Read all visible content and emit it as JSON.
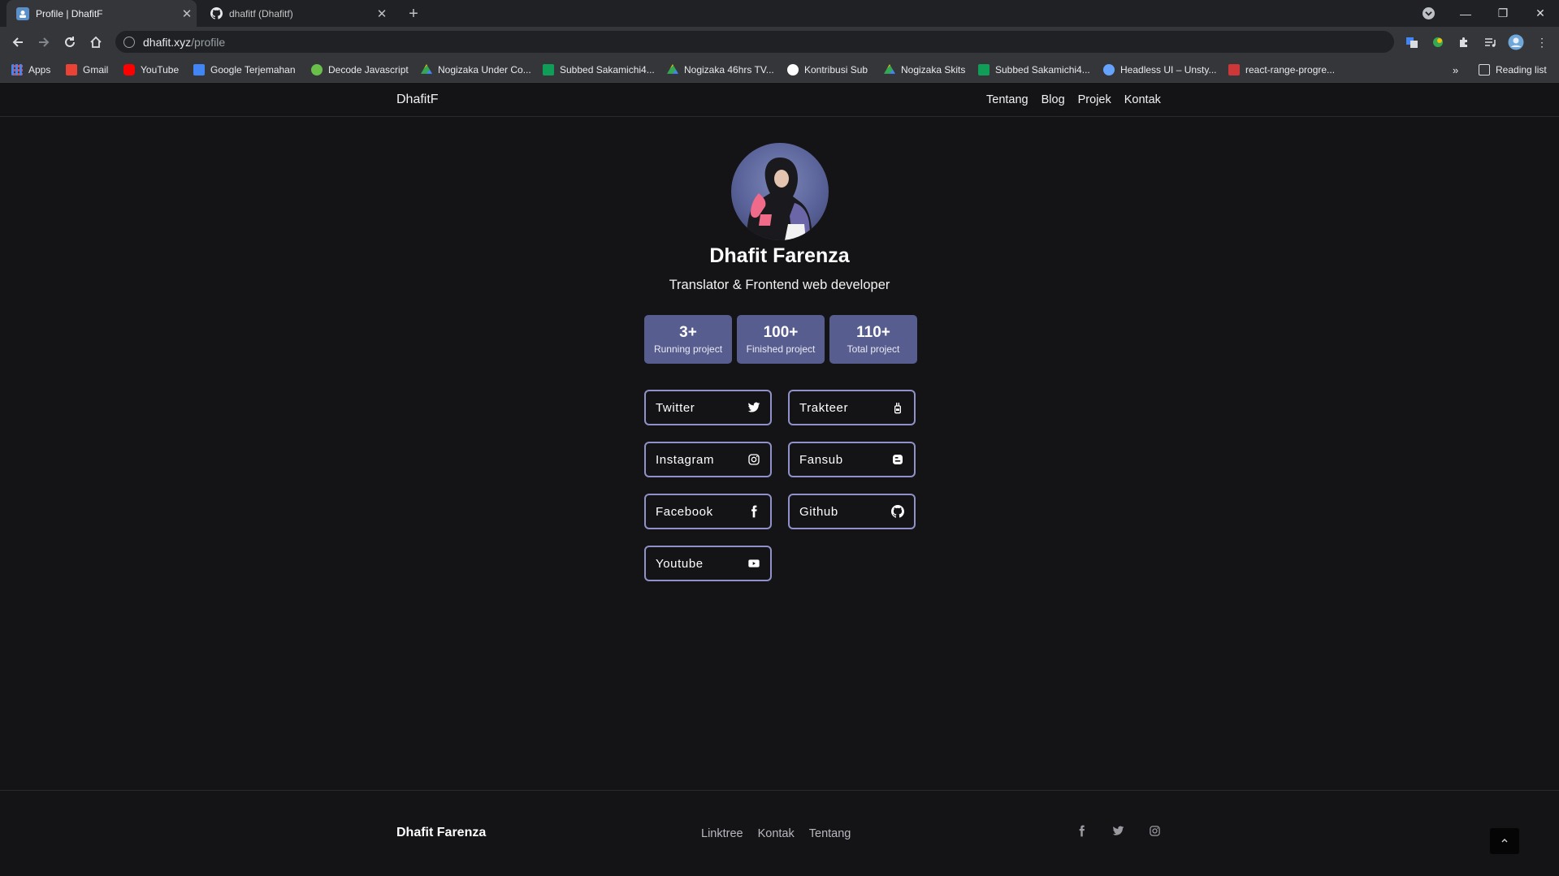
{
  "browser": {
    "tabs": [
      {
        "title": "Profile | DhafitF",
        "active": true
      },
      {
        "title": "dhafitf (Dhafitf)",
        "active": false
      }
    ],
    "address": {
      "host": "dhafit.xyz",
      "path": "/profile"
    },
    "bookmarks": [
      {
        "label": "Apps",
        "color": "#4285f4"
      },
      {
        "label": "Gmail",
        "color": "#ea4335"
      },
      {
        "label": "YouTube",
        "color": "#ff0000"
      },
      {
        "label": "Google Terjemahan",
        "color": "#4285f4"
      },
      {
        "label": "Decode Javascript",
        "color": "#6abf4b"
      },
      {
        "label": "Nogizaka Under Co...",
        "color": "#fbbc04"
      },
      {
        "label": "Subbed Sakamichi4...",
        "color": "#0f9d58"
      },
      {
        "label": "Nogizaka 46hrs TV...",
        "color": "#fbbc04"
      },
      {
        "label": "Kontribusi Sub",
        "color": "#ffffff"
      },
      {
        "label": "Nogizaka Skits",
        "color": "#fbbc04"
      },
      {
        "label": "Subbed Sakamichi4...",
        "color": "#0f9d58"
      },
      {
        "label": "Headless UI – Unsty...",
        "color": "#66a3ff"
      },
      {
        "label": "react-range-progre...",
        "color": "#cb3837"
      }
    ],
    "reading_list": "Reading list"
  },
  "site": {
    "brand": "DhafitF",
    "nav": [
      "Tentang",
      "Blog",
      "Projek",
      "Kontak"
    ],
    "profile": {
      "name": "Dhafit Farenza",
      "tagline": "Translator & Frontend web developer"
    },
    "stats": [
      {
        "value": "3+",
        "label": "Running project"
      },
      {
        "value": "100+",
        "label": "Finished project"
      },
      {
        "value": "110+",
        "label": "Total project"
      }
    ],
    "socials": [
      {
        "label": "Twitter",
        "icon": "twitter-icon"
      },
      {
        "label": "Trakteer",
        "icon": "trakteer-icon"
      },
      {
        "label": "Instagram",
        "icon": "instagram-icon"
      },
      {
        "label": "Fansub",
        "icon": "blogger-icon"
      },
      {
        "label": "Facebook",
        "icon": "facebook-icon"
      },
      {
        "label": "Github",
        "icon": "github-icon"
      },
      {
        "label": "Youtube",
        "icon": "youtube-icon"
      }
    ],
    "footer": {
      "name": "Dhafit Farenza",
      "links": [
        "Linktree",
        "Kontak",
        "Tentang"
      ],
      "icons": [
        "facebook-icon",
        "twitter-icon",
        "instagram-icon"
      ]
    },
    "accent": "#585d8f",
    "border_accent": "#8f91c8"
  }
}
